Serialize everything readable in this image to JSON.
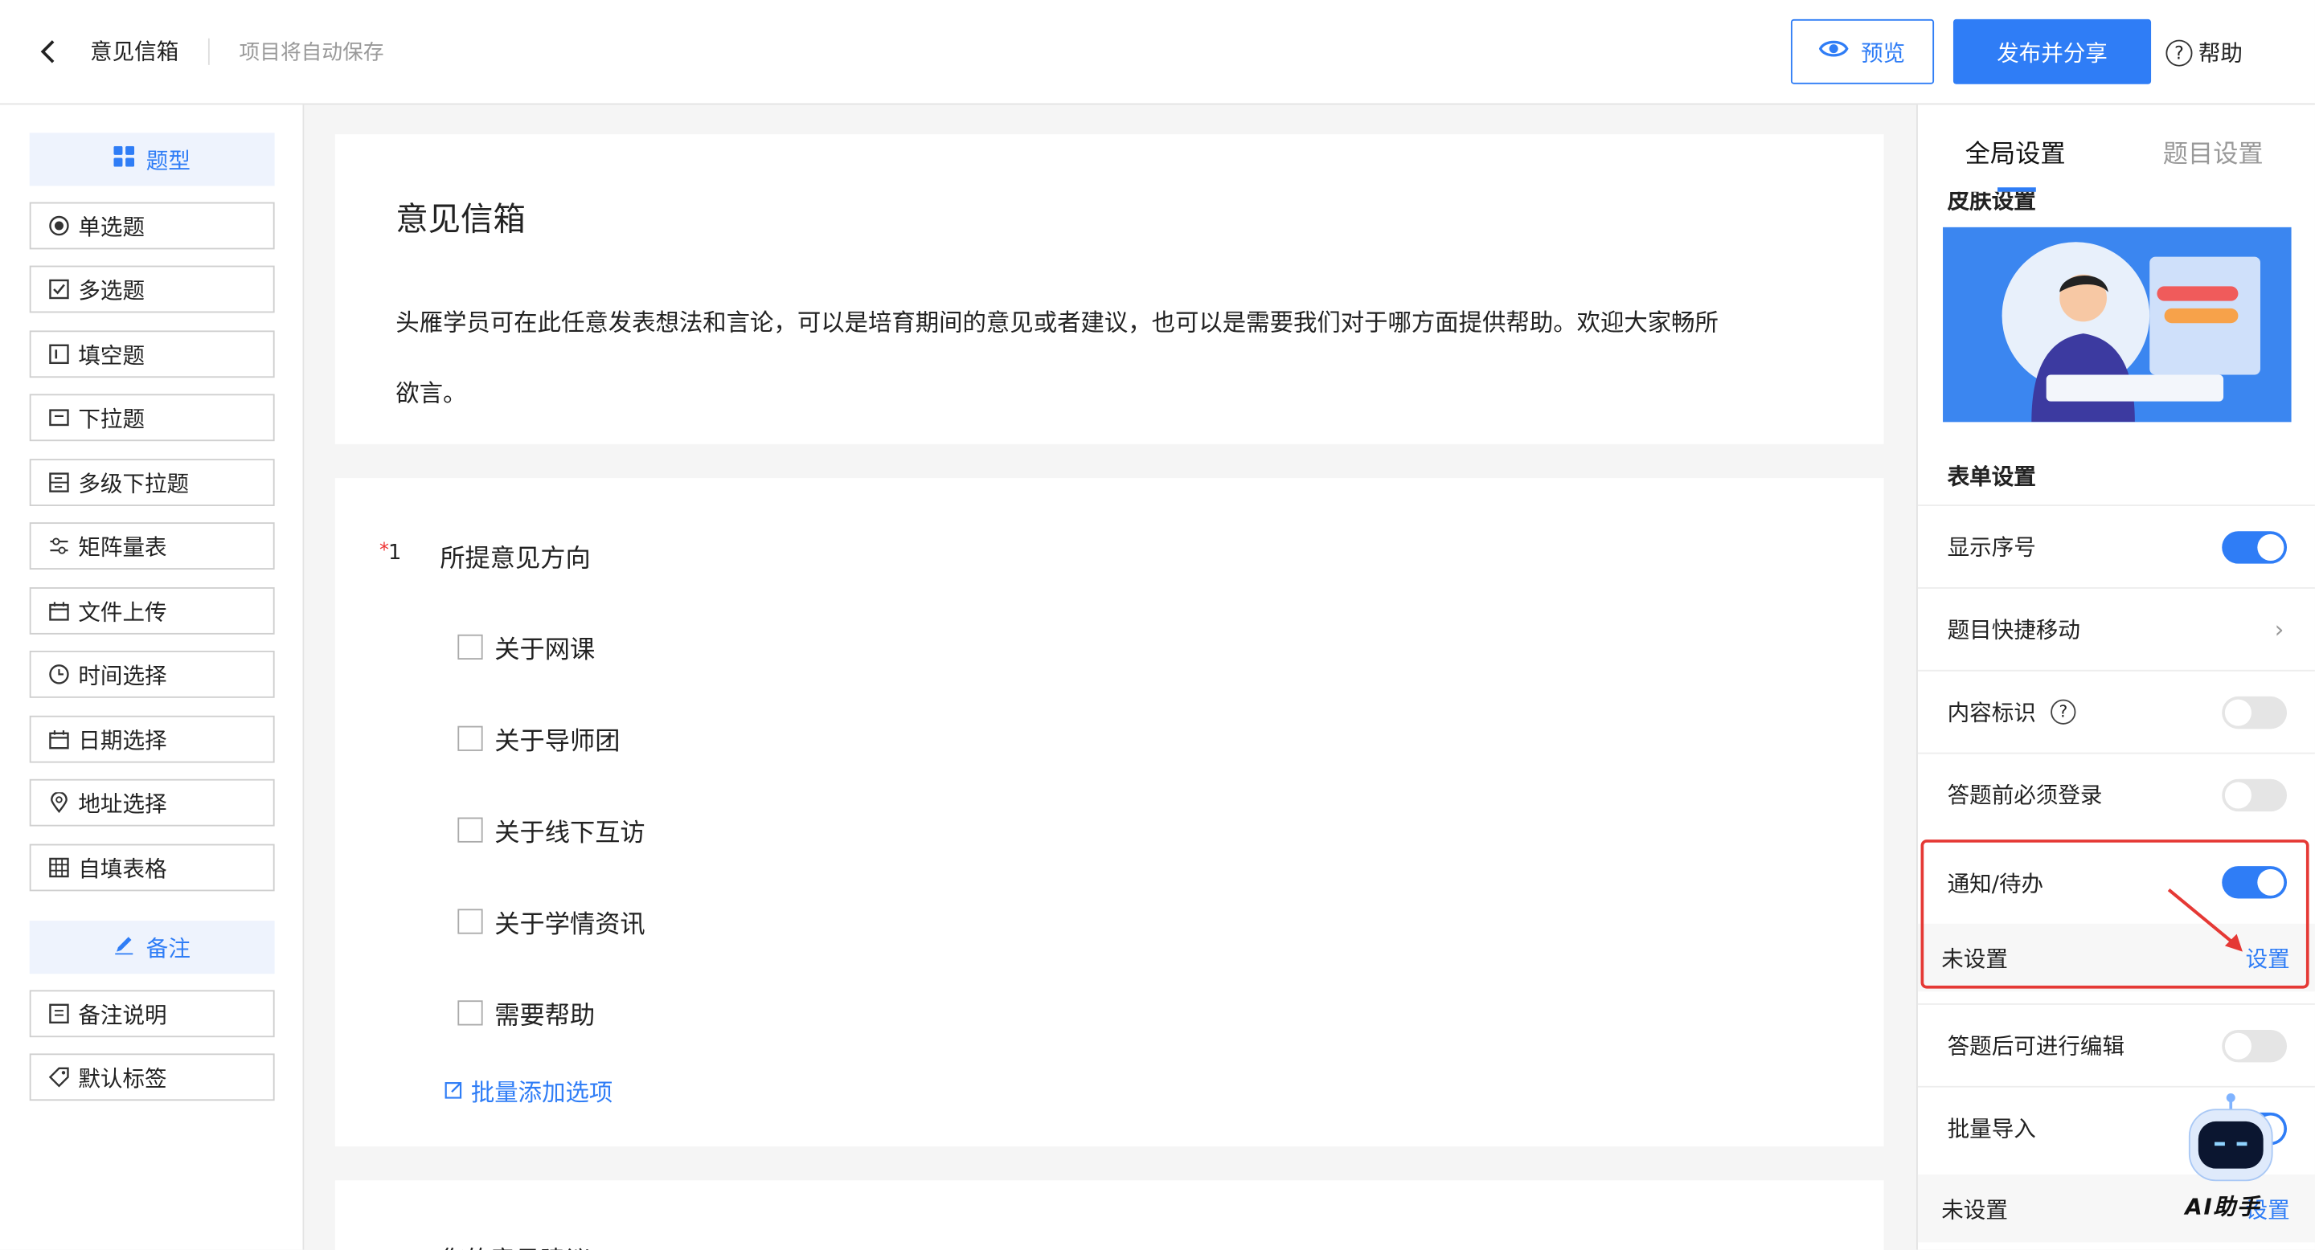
{
  "header": {
    "title": "意见信箱",
    "autosave": "项目将自动保存",
    "preview_label": "预览",
    "publish_label": "发布并分享",
    "help_label": "帮助",
    "help_mark": "?",
    "accent_color": "#2f7df6"
  },
  "left_panel": {
    "types_header": "题型",
    "types": [
      {
        "label": "单选题",
        "icon": "radio-icon"
      },
      {
        "label": "多选题",
        "icon": "checkbox-icon"
      },
      {
        "label": "填空题",
        "icon": "text-field-icon"
      },
      {
        "label": "下拉题",
        "icon": "dropdown-icon"
      },
      {
        "label": "多级下拉题",
        "icon": "multi-dropdown-icon"
      },
      {
        "label": "矩阵量表",
        "icon": "slider-icon"
      },
      {
        "label": "文件上传",
        "icon": "upload-icon"
      },
      {
        "label": "时间选择",
        "icon": "clock-icon"
      },
      {
        "label": "日期选择",
        "icon": "calendar-icon"
      },
      {
        "label": "地址选择",
        "icon": "location-icon"
      },
      {
        "label": "自填表格",
        "icon": "table-icon"
      }
    ],
    "notes_header": "备注",
    "notes": [
      {
        "label": "备注说明",
        "icon": "note-icon"
      },
      {
        "label": "默认标签",
        "icon": "tag-icon"
      }
    ]
  },
  "form": {
    "title": "意见信箱",
    "description": "头雁学员可在此任意发表想法和言论，可以是培育期间的意见或者建议，也可以是需要我们对于哪方面提供帮助。欢迎大家畅所欲言。",
    "question1": {
      "required_mark": "*",
      "number": "1",
      "title": "所提意见方向",
      "options": [
        "关于网课",
        "关于导师团",
        "关于线下互访",
        "关于学情资讯",
        "需要帮助"
      ],
      "batch_add": "批量添加选项"
    },
    "question2_peek": "您的意见建议"
  },
  "right_panel": {
    "tab_global": "全局设置",
    "tab_question": "题目设置",
    "skin_label": "皮肤设置",
    "form_settings": "表单设置",
    "rows": {
      "show_number": {
        "label": "显示序号",
        "on": true
      },
      "quick_move": {
        "label": "题目快捷移动"
      },
      "content_mark": {
        "label": "内容标识",
        "on": false
      },
      "login_required": {
        "label": "答题前必须登录",
        "on": false
      },
      "notify": {
        "label": "通知/待办",
        "on": true
      },
      "notify_sub": {
        "status": "未设置",
        "link": "设置"
      },
      "edit_after": {
        "label": "答题后可进行编辑",
        "on": false
      },
      "batch_import": {
        "label": "批量导入",
        "on": true
      },
      "batch_sub": {
        "status": "未设置",
        "link": "设置"
      }
    },
    "ai_label": "AI助手"
  }
}
